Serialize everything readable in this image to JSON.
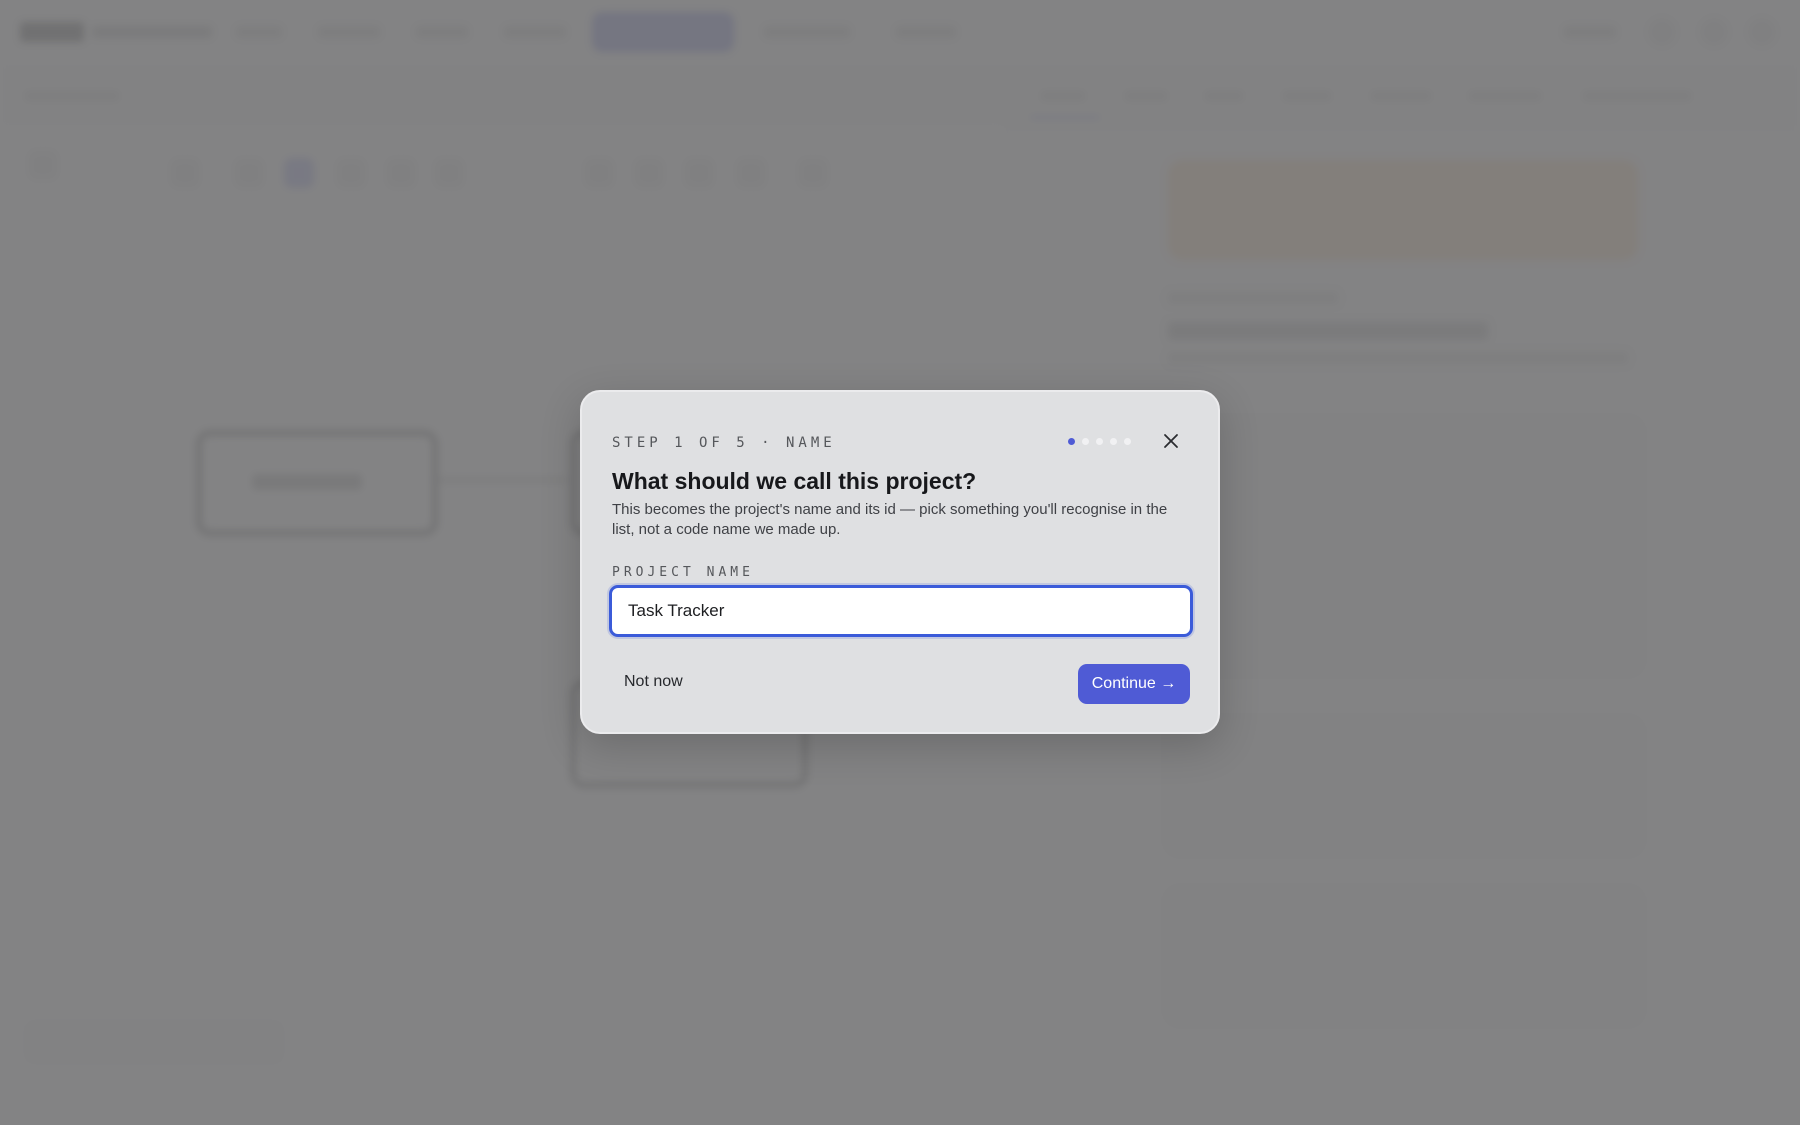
{
  "modal": {
    "step_label": "STEP 1 OF 5 · NAME",
    "step_current": 1,
    "step_total": 5,
    "title": "What should we call this project?",
    "description": "This becomes the project's name and its id — pick something you'll recognise in the list, not a code name we made up.",
    "field_label": "PROJECT NAME",
    "project_name_value": "Task Tracker",
    "not_now_label": "Not now",
    "continue_label": "Continue →",
    "close_icon": "close-icon"
  },
  "colors": {
    "accent": "#4f5bd5",
    "input_border": "#3b5bd9",
    "overlay": "#78787a"
  }
}
